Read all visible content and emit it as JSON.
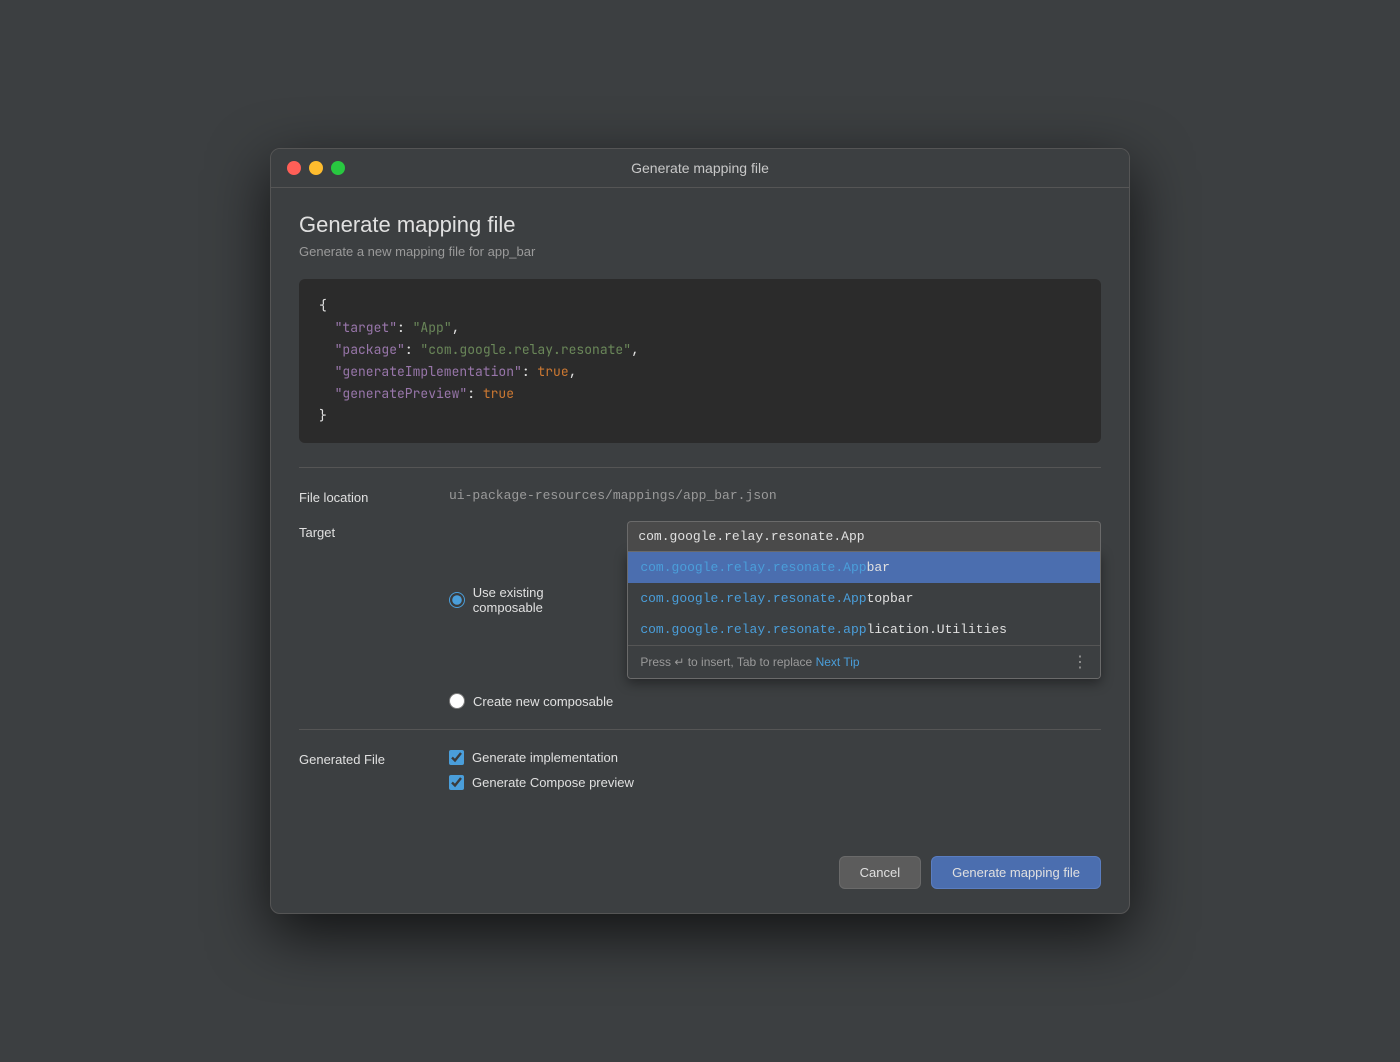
{
  "titleBar": {
    "title": "Generate mapping file"
  },
  "header": {
    "heading": "Generate mapping file",
    "subheading": "Generate a new mapping file for app_bar"
  },
  "codeBlock": {
    "line1": "{",
    "line2_key": "\"target\"",
    "line2_value": "\"App\"",
    "line3_key": "\"package\"",
    "line3_value": "\"com.google.relay.resonate\"",
    "line4_key": "\"generateImplementation\"",
    "line4_value": "true",
    "line5_key": "\"generatePreview\"",
    "line5_value": "true",
    "line6": "}"
  },
  "form": {
    "fileLocation": {
      "label": "File location",
      "value": "ui-package-resources/mappings/app_bar.json"
    },
    "target": {
      "label": "Target",
      "options": [
        {
          "id": "use-existing",
          "label": "Use existing composable",
          "checked": true
        },
        {
          "id": "create-new",
          "label": "Create new composable",
          "checked": false
        }
      ]
    },
    "autocomplete": {
      "inputValue": "com.google.relay.resonate.App|",
      "items": [
        {
          "base": "com.google.relay.resonate.App",
          "suffix": "bar",
          "selected": true
        },
        {
          "base": "com.google.relay.resonate.App",
          "suffix": "topbar",
          "selected": false
        },
        {
          "base": "com.google.relay.resonate.app",
          "suffix": "lication.Utilities",
          "selected": false
        }
      ],
      "hint": "Press ↵ to insert, Tab to replace",
      "hintLink": "Next Tip"
    },
    "generatedFile": {
      "label": "Generated File",
      "checkboxes": [
        {
          "id": "gen-impl",
          "label": "Generate implementation",
          "checked": true
        },
        {
          "id": "gen-preview",
          "label": "Generate Compose preview",
          "checked": true
        }
      ]
    }
  },
  "footer": {
    "cancelLabel": "Cancel",
    "generateLabel": "Generate mapping file"
  }
}
